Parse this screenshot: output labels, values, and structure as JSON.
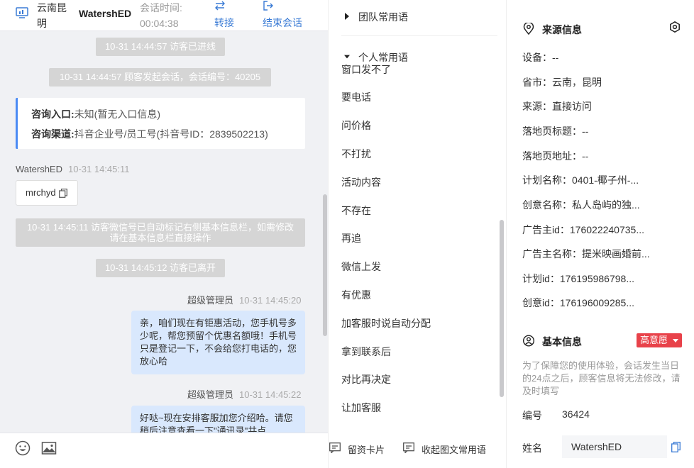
{
  "header": {
    "location": "云南昆明",
    "visitor_name": "WatershED",
    "session_time_label": "会话时间:",
    "session_time_value": "00:04:38",
    "transfer_label": "转接",
    "end_label": "结束会话"
  },
  "messages": {
    "sys1": "10-31 14:44:57 访客已进线",
    "sys2": "10-31 14:44:57 顾客发起会话，会话编号：40205",
    "entry_label": "咨询入口:",
    "entry_value": "未知(暂无入口信息)",
    "channel_label": "咨询渠道:",
    "channel_value": "抖音企业号/员工号(抖音号ID：2839502213)",
    "visitor_sender": "WatershED",
    "visitor_time": "10-31 14:45:11",
    "visitor_msg": "mrchyd",
    "sys3": "10-31 14:45:11 访客微信号已自动标记右侧基本信息栏，如需修改请在基本信息栏直接操作",
    "sys4": "10-31 14:45:12 访客已离开",
    "agent1_sender": "超级管理员",
    "agent1_time": "10-31 14:45:20",
    "agent1_msg": "亲，咱们现在有钜惠活动，您手机号多少呢，帮您预留个优惠名额哦！手机号只是登记一下，不会给您打电话的，您放心哈",
    "agent2_sender": "超级管理员",
    "agent2_time": "10-31 14:45:22",
    "agent2_msg": "好哒~现在安排客服加您介绍哈。请您稍后注意查看一下\"通讯录\"共点"
  },
  "replies": {
    "team_group": "团队常用语",
    "personal_group": "个人常用语",
    "items": [
      "窗口发不了",
      "要电话",
      "问价格",
      "不打扰",
      "活动内容",
      "不存在",
      "再追",
      "微信上发",
      "有优惠",
      "加客服时说自动分配",
      "拿到联系后",
      "对比再决定",
      "让加客服"
    ],
    "leave_card": "留资卡片",
    "collapse": "收起图文常用语"
  },
  "source_info": {
    "title": "来源信息",
    "rows": [
      "设备：--",
      "省市：云南，昆明",
      "来源：直接访问",
      "落地页标题：--",
      "落地页地址：--",
      "计划名称：0401-椰子州-...",
      "创意名称：私人岛屿的独...",
      "广告主id：176022240735...",
      "广告主名称：提米映画婚前...",
      "计划id：176195986798...",
      "创意id：176196009285..."
    ]
  },
  "basic_info": {
    "title": "基本信息",
    "badge": "高意愿",
    "note": "为了保障您的使用体验，会话发生当日的24点之后，顾客信息将无法修改，请及时填写",
    "id_label": "编号",
    "id_value": "36424",
    "name_label": "姓名",
    "name_value": "WatershED"
  },
  "colors": {
    "accent": "#3a7bd5",
    "bubble": "#d9e8fd",
    "badge": "#e8424a",
    "card_border": "#4a8af4"
  }
}
